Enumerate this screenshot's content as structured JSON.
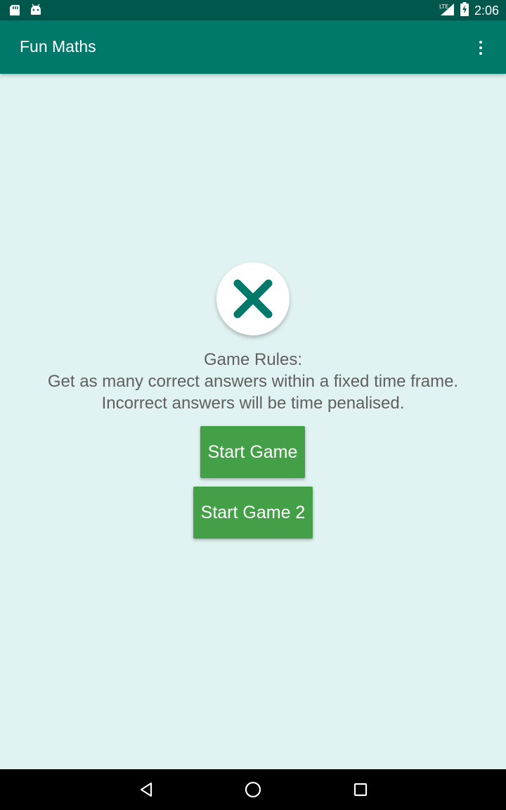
{
  "status_bar": {
    "time": "2:06",
    "left_icons": [
      "sd-card-icon",
      "android-icon"
    ],
    "right_icons": [
      "lte-signal-icon",
      "battery-charging-icon"
    ],
    "network_label": "LTE"
  },
  "app_bar": {
    "title": "Fun Maths",
    "menu_icon": "more-vert-icon"
  },
  "main": {
    "logo_icon": "multiply-x-icon",
    "rules_title": "Game Rules:",
    "rules_line1": "Get as many correct answers within a fixed time frame.",
    "rules_line2": "Incorrect answers will be time penalised.",
    "start_game_label": "Start Game",
    "start_game2_label": "Start Game 2"
  },
  "nav_bar": {
    "icons": [
      "back-icon",
      "home-icon",
      "recents-icon"
    ]
  },
  "colors": {
    "status_bar": "#00574b",
    "app_bar": "#00796b",
    "background": "#e0f2f1",
    "button": "#43a047",
    "logo_x": "#00796b",
    "text": "#606060"
  }
}
